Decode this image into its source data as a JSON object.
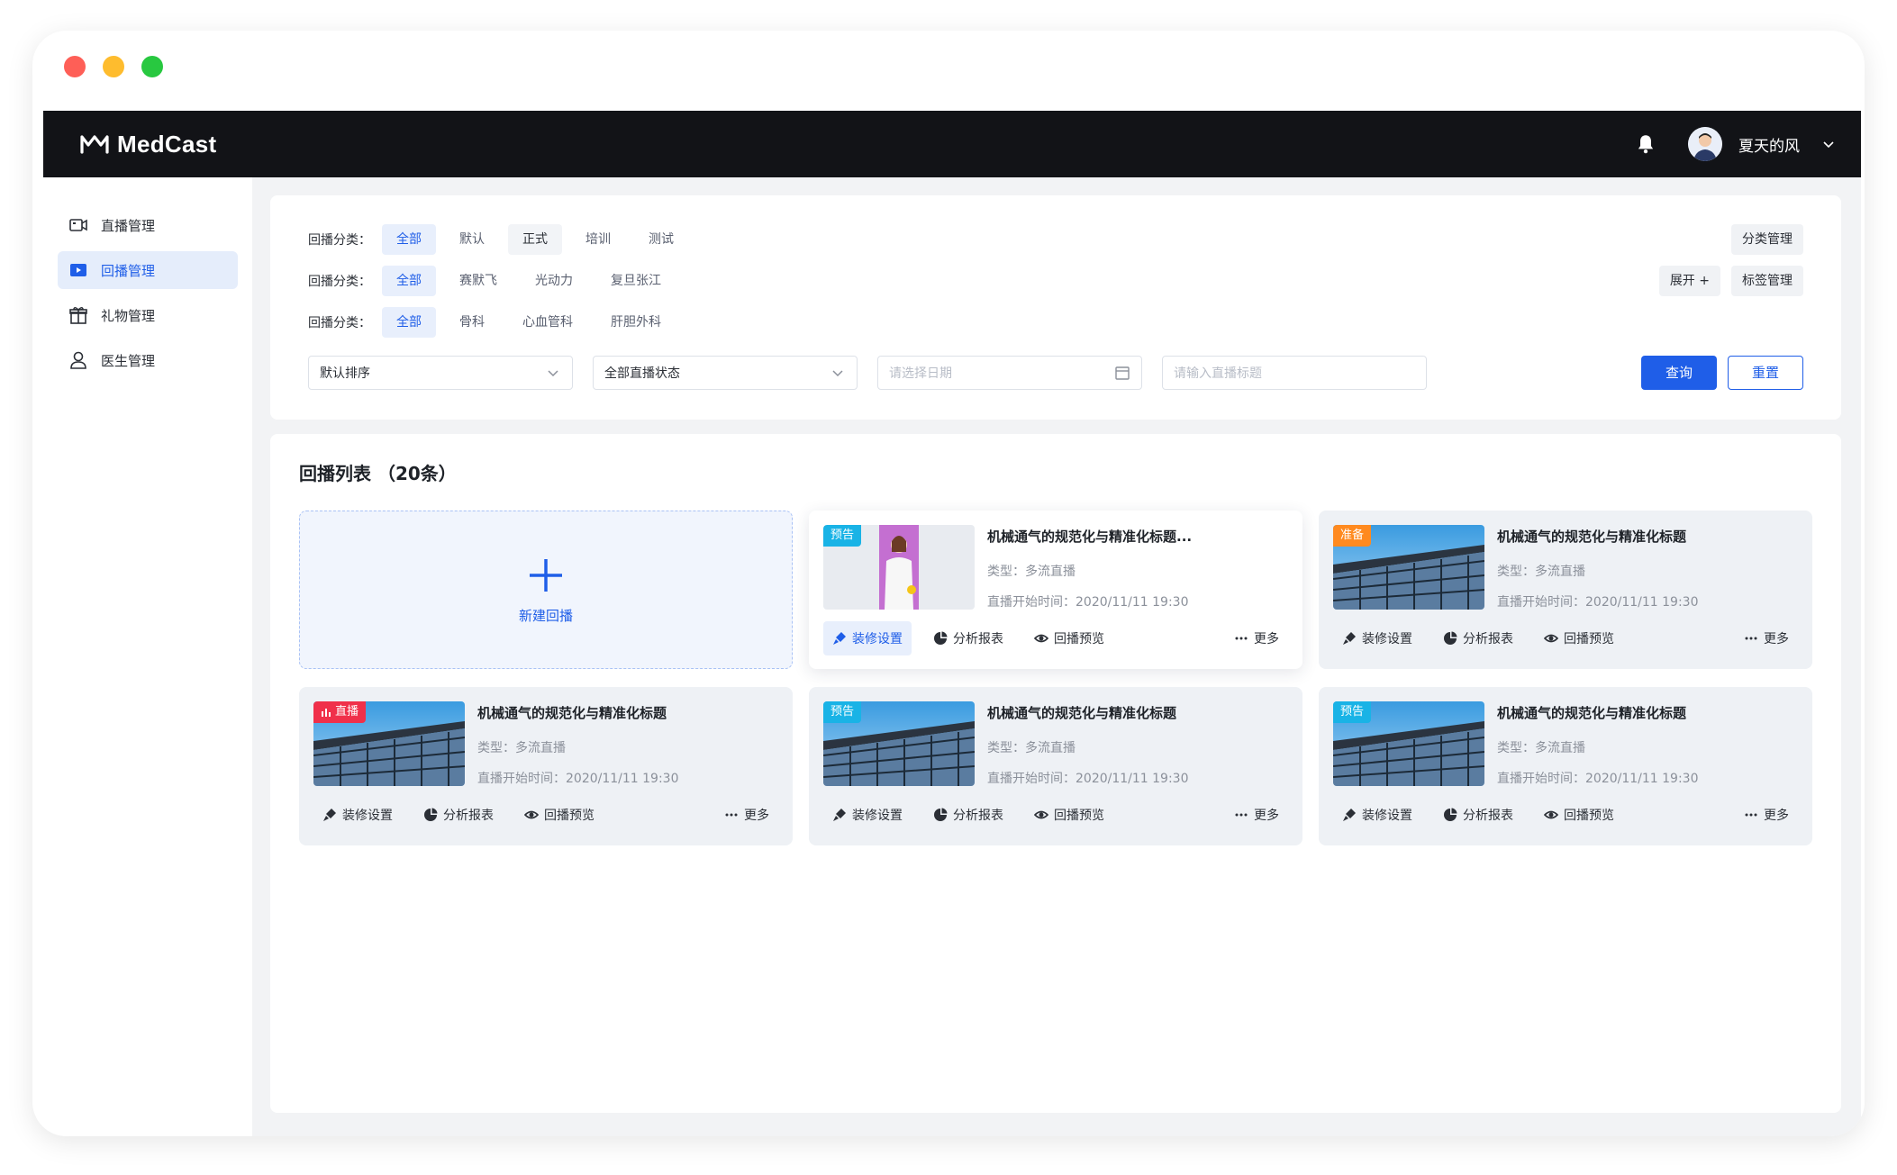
{
  "app": {
    "name": "MedCast",
    "user_name": "夏天的风"
  },
  "sidebar": {
    "items": [
      {
        "label": "直播管理",
        "icon": "video-camera-icon"
      },
      {
        "label": "回播管理",
        "icon": "play-icon"
      },
      {
        "label": "礼物管理",
        "icon": "gift-icon"
      },
      {
        "label": "医生管理",
        "icon": "user-icon"
      }
    ]
  },
  "filters": {
    "rows": [
      {
        "label": "回播分类：",
        "options": [
          "全部",
          "默认",
          "正式",
          "培训",
          "测试"
        ]
      },
      {
        "label": "回播分类：",
        "options": [
          "全部",
          "赛默飞",
          "光动力",
          "复旦张江"
        ]
      },
      {
        "label": "回播分类：",
        "options": [
          "全部",
          "骨科",
          "心血管科",
          "肝胆外科"
        ]
      }
    ],
    "category_manage": "分类管理",
    "expand": "展开 +",
    "tag_manage": "标签管理",
    "sort_select": "默认排序",
    "status_select": "全部直播状态",
    "date_placeholder": "请选择日期",
    "title_placeholder": "请输入直播标题",
    "query": "查询",
    "reset": "重置"
  },
  "list": {
    "title": "回播列表 （20条）",
    "new_label": "新建回播",
    "cards": [
      {
        "tag": "预告",
        "title": "机械通气的规范化与精准化标题...",
        "type": "类型：多流直播",
        "time": "直播开始时间：2020/11/11  19:30"
      },
      {
        "tag": "准备",
        "title": "机械通气的规范化与精准化标题",
        "type": "类型：多流直播",
        "time": "直播开始时间：2020/11/11  19:30"
      },
      {
        "tag": "直播",
        "title": "机械通气的规范化与精准化标题",
        "type": "类型：多流直播",
        "time": "直播开始时间：2020/11/11  19:30"
      },
      {
        "tag": "预告",
        "title": "机械通气的规范化与精准化标题",
        "type": "类型：多流直播",
        "time": "直播开始时间：2020/11/11  19:30"
      },
      {
        "tag": "预告",
        "title": "机械通气的规范化与精准化标题",
        "type": "类型：多流直播",
        "time": "直播开始时间：2020/11/11  19:30"
      }
    ],
    "actions": {
      "decorate": "装修设置",
      "report": "分析报表",
      "preview": "回播预览",
      "more": "更多"
    }
  }
}
